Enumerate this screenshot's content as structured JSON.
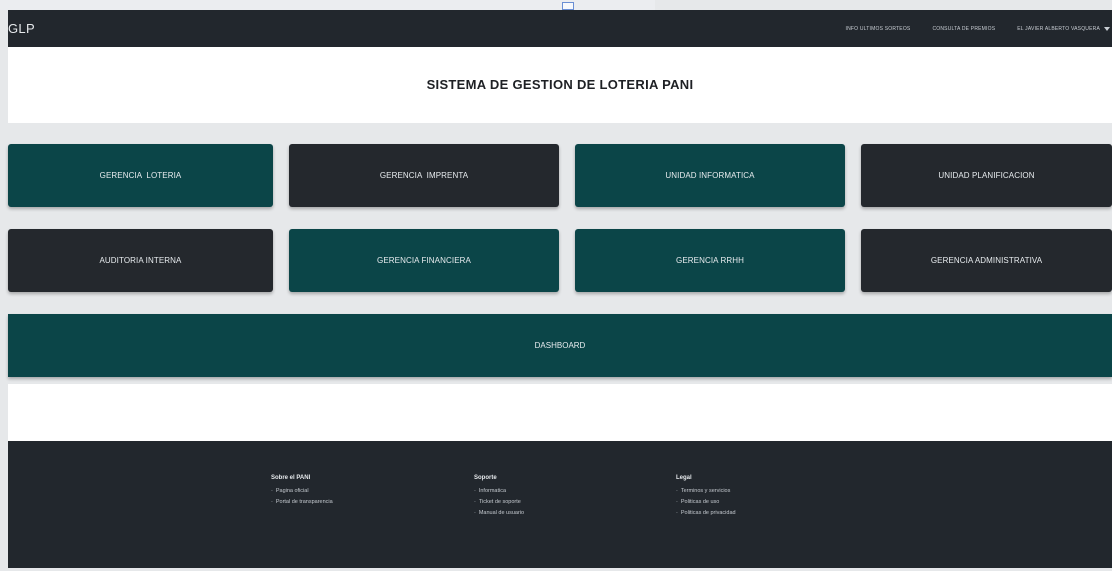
{
  "navbar": {
    "brand": "GLP",
    "links": [
      {
        "label": "INFO ULTIMOS SORTEOS"
      },
      {
        "label": "CONSULTA DE PREMIOS"
      }
    ],
    "user": "EL JAVIER ALBERTO VASQUERA"
  },
  "page_title": "SISTEMA DE GESTION DE LOTERIA PANI",
  "tiles": [
    {
      "label": "GERENCIA  LOTERIA",
      "color": "#0b4548"
    },
    {
      "label": "GERENCIA  IMPRENTA",
      "color": "#24282d"
    },
    {
      "label": "UNIDAD INFORMATICA",
      "color": "#0b4548"
    },
    {
      "label": "UNIDAD PLANIFICACION",
      "color": "#24282d"
    },
    {
      "label": "AUDITORIA INTERNA",
      "color": "#24282d"
    },
    {
      "label": "GERENCIA FINANCIERA",
      "color": "#0b4548"
    },
    {
      "label": "GERENCIA RRHH",
      "color": "#0b4548"
    },
    {
      "label": "GERENCIA ADMINISTRATIVA",
      "color": "#24282d"
    }
  ],
  "dashboard": {
    "label": "DASHBOARD",
    "color": "#0b4548"
  },
  "footer": {
    "columns": [
      {
        "heading": "Sobre el PANI",
        "links": [
          "Pagina oficial",
          "Portal de transparencia"
        ]
      },
      {
        "heading": "Soporte",
        "links": [
          "Informatica",
          "Ticket de soporte",
          "Manual de usuario"
        ]
      },
      {
        "heading": "Legal",
        "links": [
          "Terminos y servicios",
          "Politicas de uso",
          "Politicas de privacidad"
        ]
      }
    ],
    "link_prefix": "-"
  },
  "colors": {
    "teal": "#0b4548",
    "dark": "#24282d",
    "navbar": "#22272d",
    "background": "#e6e8ea"
  }
}
